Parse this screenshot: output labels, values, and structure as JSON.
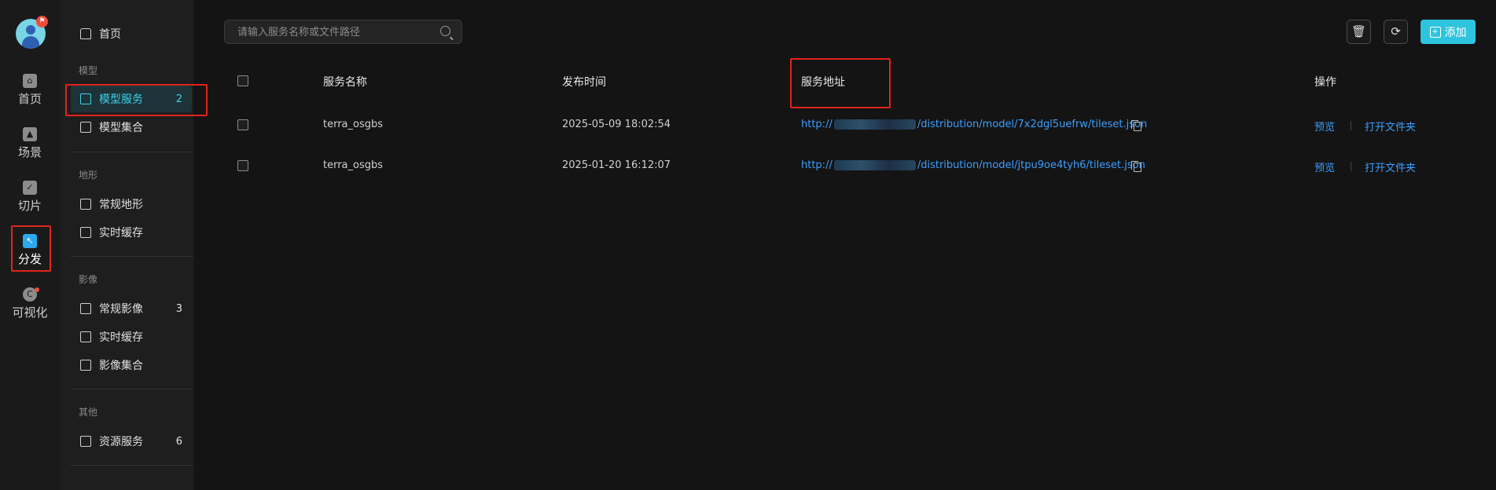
{
  "rail": {
    "avatar_badge": "⚑",
    "items": [
      {
        "label": "首页",
        "icon": "home-icon"
      },
      {
        "label": "场景",
        "icon": "scene-icon"
      },
      {
        "label": "切片",
        "icon": "tile-icon"
      },
      {
        "label": "分发",
        "icon": "distribute-icon"
      },
      {
        "label": "可视化",
        "icon": "visualize-icon"
      }
    ]
  },
  "menu": {
    "home": "首页",
    "sections": [
      {
        "title": "模型",
        "items": [
          {
            "label": "模型服务",
            "count": "2"
          },
          {
            "label": "模型集合",
            "count": ""
          }
        ]
      },
      {
        "title": "地形",
        "items": [
          {
            "label": "常规地形",
            "count": ""
          },
          {
            "label": "实时缓存",
            "count": ""
          }
        ]
      },
      {
        "title": "影像",
        "items": [
          {
            "label": "常规影像",
            "count": "3"
          },
          {
            "label": "实时缓存",
            "count": ""
          },
          {
            "label": "影像集合",
            "count": ""
          }
        ]
      },
      {
        "title": "其他",
        "items": [
          {
            "label": "资源服务",
            "count": "6"
          }
        ]
      }
    ]
  },
  "search": {
    "placeholder": "请输入服务名称或文件路径"
  },
  "toolbar": {
    "delete_icon": "trash-icon",
    "refresh_icon": "refresh-icon",
    "add_label": "添加"
  },
  "table": {
    "headers": {
      "name": "服务名称",
      "time": "发布时间",
      "url": "服务地址",
      "ops": "操作"
    },
    "rows": [
      {
        "name": "terra_osgbs",
        "time": "2025-05-09 18:02:54",
        "url_prefix": "http://",
        "url_suffix": "/distribution/model/7x2dgl5uefrw/tileset.json",
        "preview": "预览",
        "open": "打开文件夹"
      },
      {
        "name": "terra_osgbs",
        "time": "2025-01-20 16:12:07",
        "url_prefix": "http://",
        "url_suffix": "/distribution/model/jtpu9oe4tyh6/tileset.json",
        "preview": "预览",
        "open": "打开文件夹"
      }
    ]
  },
  "colors": {
    "accent": "#2ec4de",
    "link": "#3b9fff",
    "highlight": "#e0241a",
    "active_menu_bg": "#1d3338"
  }
}
